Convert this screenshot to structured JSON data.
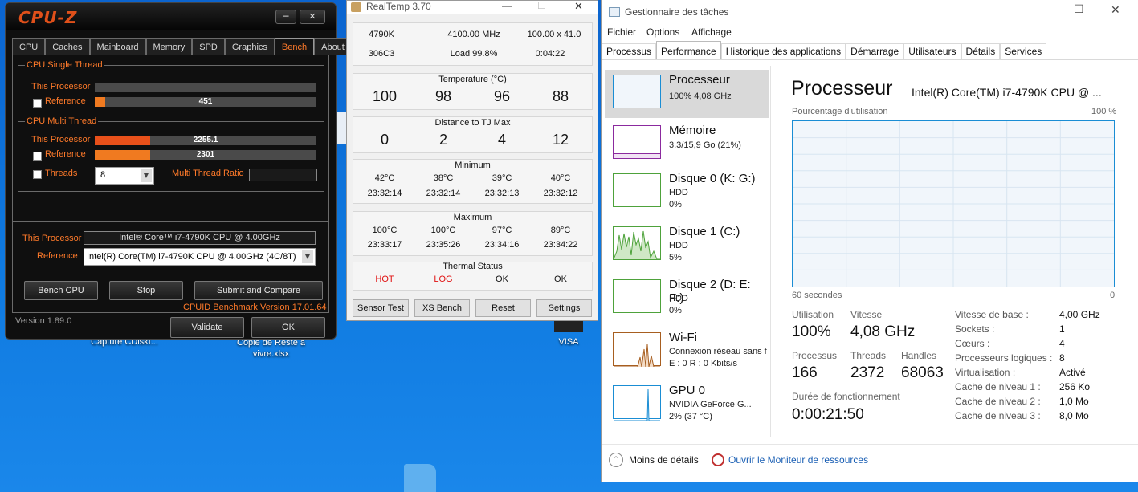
{
  "desktop": {
    "icons": [
      "Capture CDiskI...",
      "Copie de Reste à vivre.xlsx",
      "VISA"
    ]
  },
  "cpuz": {
    "logo": "CPU-Z",
    "tabs": [
      "CPU",
      "Caches",
      "Mainboard",
      "Memory",
      "SPD",
      "Graphics",
      "Bench",
      "About"
    ],
    "active_tab": "Bench",
    "single_thread": {
      "title": "CPU Single Thread",
      "this_label": "This Processor",
      "this_value": "",
      "this_fraction": 0.0,
      "ref_label": "Reference",
      "ref_value": "451",
      "ref_fraction": 0.047
    },
    "multi_thread": {
      "title": "CPU Multi Thread",
      "this_label": "This Processor",
      "this_value": "2255.1",
      "this_fraction": 0.25,
      "ref_label": "Reference",
      "ref_value": "2301",
      "ref_fraction": 0.25,
      "threads_label": "Threads",
      "threads_value": "8",
      "ratio_label": "Multi Thread Ratio",
      "ratio_value": ""
    },
    "this_processor_label": "This Processor",
    "this_processor_value": "Intel® Core™ i7-4790K CPU @ 4.00GHz",
    "reference_label": "Reference",
    "reference_value": "Intel(R) Core(TM) i7-4790K CPU @ 4.00GHz (4C/8T)",
    "buttons": {
      "bench": "Bench CPU",
      "stop": "Stop",
      "submit": "Submit and Compare",
      "validate": "Validate",
      "ok": "OK"
    },
    "benchmark_version": "CPUID Benchmark Version 17.01.64",
    "version": "Version 1.89.0"
  },
  "realtemp": {
    "title": "RealTemp 3.70",
    "info": {
      "cpu": "4790K",
      "freq": "4100.00 MHz",
      "mult": "100.00 x 41.0",
      "id": "306C3",
      "load": "Load  99.8%",
      "time": "0:04:22"
    },
    "temperature": {
      "caption": "Temperature (°C)",
      "values": [
        "100",
        "98",
        "96",
        "88"
      ]
    },
    "distance": {
      "caption": "Distance to TJ Max",
      "values": [
        "0",
        "2",
        "4",
        "12"
      ]
    },
    "minimum": {
      "caption": "Minimum",
      "temps": [
        "42°C",
        "38°C",
        "39°C",
        "40°C"
      ],
      "times": [
        "23:32:14",
        "23:32:14",
        "23:32:13",
        "23:32:12"
      ]
    },
    "maximum": {
      "caption": "Maximum",
      "temps": [
        "100°C",
        "100°C",
        "97°C",
        "89°C"
      ],
      "times": [
        "23:33:17",
        "23:35:26",
        "23:34:16",
        "23:34:22"
      ]
    },
    "thermal": {
      "caption": "Thermal Status",
      "values": [
        "HOT",
        "LOG",
        "OK",
        "OK"
      ]
    },
    "buttons": [
      "Sensor Test",
      "XS Bench",
      "Reset",
      "Settings"
    ]
  },
  "taskmgr": {
    "title": "Gestionnaire des tâches",
    "menu": [
      "Fichier",
      "Options",
      "Affichage"
    ],
    "tabs": [
      "Processus",
      "Performance",
      "Historique des applications",
      "Démarrage",
      "Utilisateurs",
      "Détails",
      "Services"
    ],
    "active_tab": "Performance",
    "sidebar": [
      {
        "name": "Processeur",
        "line1": "100% 4,08 GHz",
        "line2": ""
      },
      {
        "name": "Mémoire",
        "line1": "3,3/15,9 Go (21%)",
        "line2": ""
      },
      {
        "name": "Disque 0 (K: G:)",
        "line1": "HDD",
        "line2": "0%"
      },
      {
        "name": "Disque 1 (C:)",
        "line1": "HDD",
        "line2": "5%"
      },
      {
        "name": "Disque 2 (D: E: F:)",
        "line1": "HDD",
        "line2": "0%"
      },
      {
        "name": "Wi-Fi",
        "line1": "Connexion réseau sans f",
        "line2": "E : 0 R : 0 Kbits/s"
      },
      {
        "name": "GPU 0",
        "line1": "NVIDIA GeForce G...",
        "line2": "2% (37 °C)"
      }
    ],
    "main": {
      "title": "Processeur",
      "cpu_name": "Intel(R) Core(TM) i7-4790K CPU @ ...",
      "graph_label": "Pourcentage d'utilisation",
      "graph_max": "100 %",
      "graph_time": "60 secondes",
      "graph_min": "0",
      "utilisation_label": "Utilisation",
      "utilisation_value": "100%",
      "vitesse_label": "Vitesse",
      "vitesse_value": "4,08 GHz",
      "processus_label": "Processus",
      "processus_value": "166",
      "threads_label": "Threads",
      "threads_value": "2372",
      "handles_label": "Handles",
      "handles_value": "68063",
      "uptime_label": "Durée de fonctionnement",
      "uptime_value": "0:00:21:50",
      "specs": [
        {
          "label": "Vitesse de base :",
          "value": "4,00 GHz"
        },
        {
          "label": "Sockets :",
          "value": "1"
        },
        {
          "label": "Cœurs :",
          "value": "4"
        },
        {
          "label": "Processeurs logiques :",
          "value": "8"
        },
        {
          "label": "Virtualisation :",
          "value": "Activé"
        },
        {
          "label": "Cache de niveau 1 :",
          "value": "256 Ko"
        },
        {
          "label": "Cache de niveau 2 :",
          "value": "1,0 Mo"
        },
        {
          "label": "Cache de niveau 3 :",
          "value": "8,0 Mo"
        }
      ]
    },
    "footer": {
      "less": "Moins de détails",
      "monitor": "Ouvrir le Moniteur de ressources"
    }
  }
}
